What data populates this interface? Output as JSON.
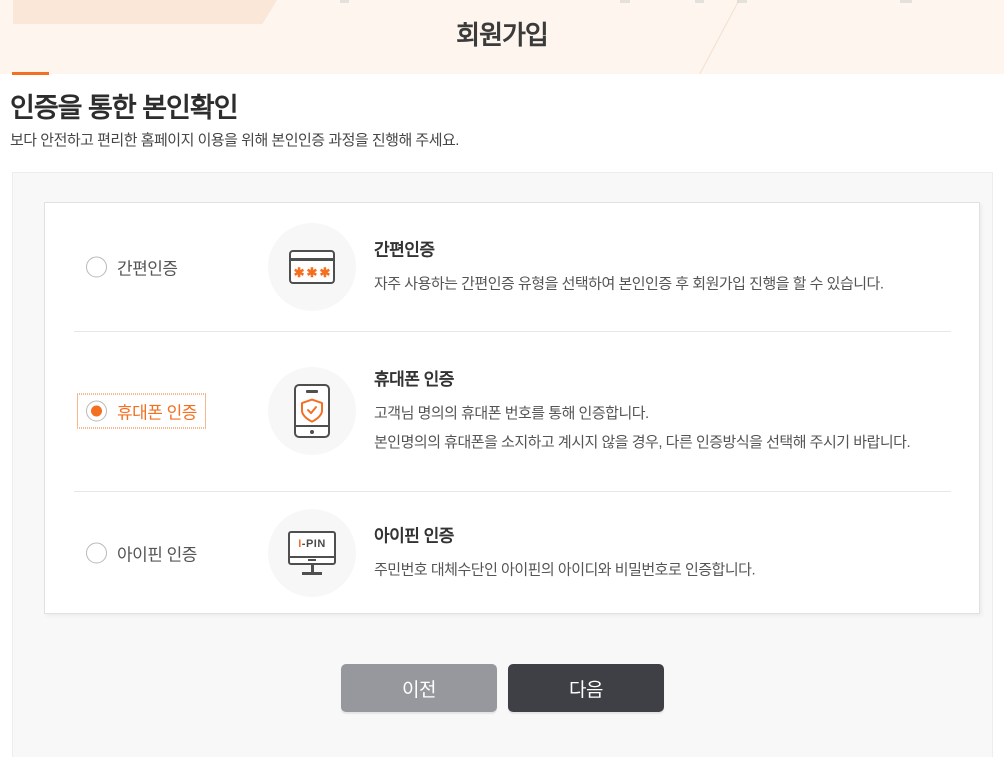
{
  "page": {
    "title": "회원가입"
  },
  "section": {
    "heading": "인증을 통한 본인확인",
    "description": "보다 안전하고 편리한 홈페이지 이용을 위해 본인인증 과정을 진행해 주세요."
  },
  "options": [
    {
      "label": "간편인증",
      "title": "간편인증",
      "desc": "자주 사용하는 간편인증 유형을 선택하여 본인인증 후 회원가입 진행을 할 수 있습니다.",
      "selected": false,
      "icon": "card-password-icon"
    },
    {
      "label": "휴대폰 인증",
      "title": "휴대폰 인증",
      "desc": "고객님 명의의 휴대폰 번호를 통해 인증합니다.",
      "desc2": "본인명의의 휴대폰을 소지하고 계시지 않을 경우, 다른 인증방식을 선택해 주시기 바랍니다.",
      "selected": true,
      "icon": "phone-shield-icon"
    },
    {
      "label": "아이핀 인증",
      "title": "아이핀 인증",
      "desc": "주민번호 대체수단인 아이핀의 아이디와 비밀번호로 인증합니다.",
      "selected": false,
      "icon": "ipin-monitor-icon"
    }
  ],
  "icons": {
    "card_asterisks": "✱✱✱",
    "ipin_i": "I",
    "ipin_rest": "-PIN"
  },
  "buttons": {
    "prev": "이전",
    "next": "다음"
  },
  "colors": {
    "accent": "#f36f21",
    "prev_bg": "#97989d",
    "next_bg": "#3f4045",
    "banner_bg": "#fdf5ee"
  }
}
